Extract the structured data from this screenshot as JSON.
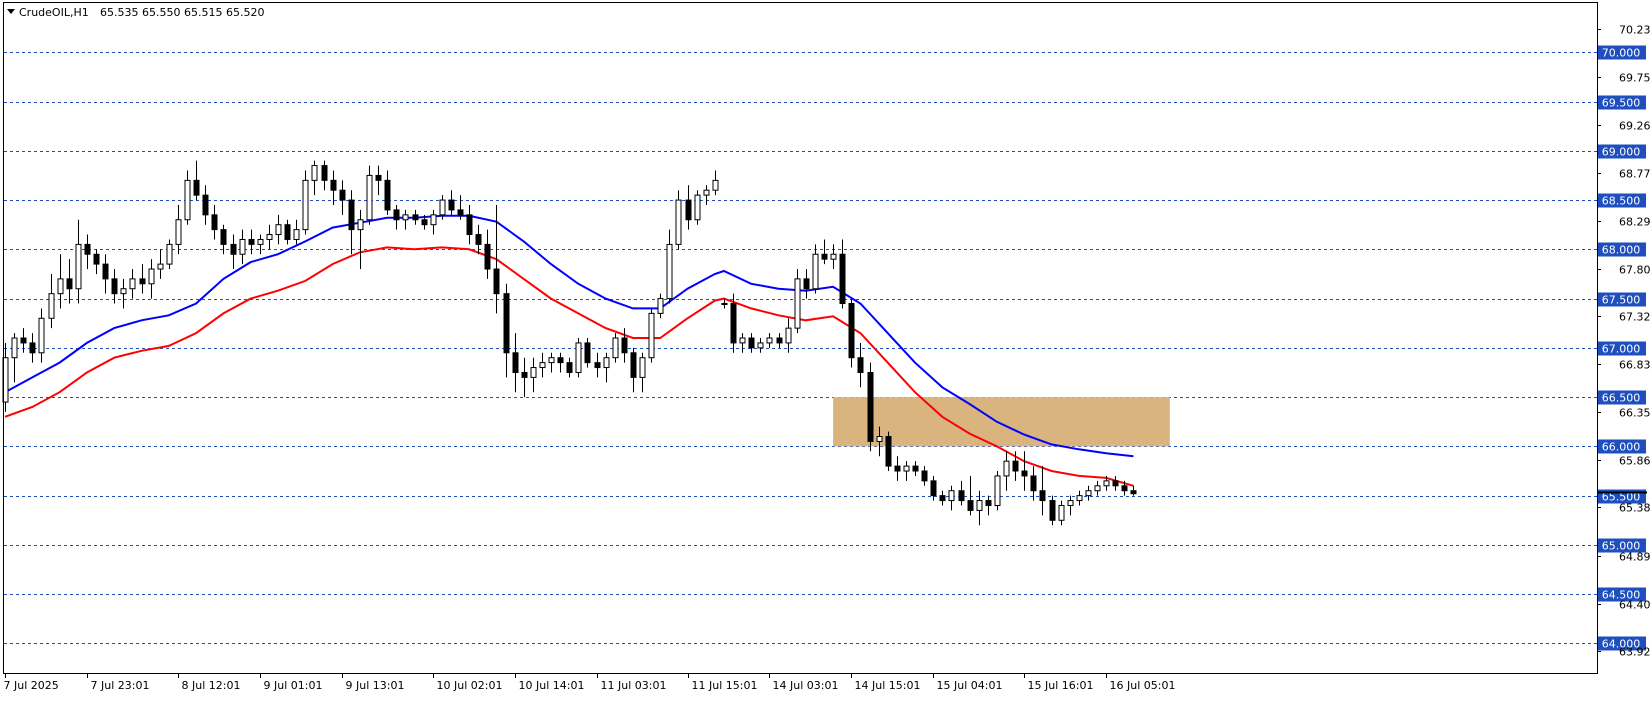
{
  "header": {
    "symbol": "CrudeOIL,H1",
    "ohlc": "65.535 65.550 65.515 65.520"
  },
  "colors": {
    "ma_fast": "#ff0000",
    "ma_slow": "#0000ff",
    "level_line": "#1f4fbf",
    "level_badge": "#1f4fbf",
    "resistance_zone": "#d9b47f",
    "candle": "#000000"
  },
  "icons": {
    "header_menu": "triangle-down-icon"
  },
  "chart_data": {
    "type": "candlestick",
    "title": "CrudeOIL,H1",
    "ylim": [
      63.7,
      70.5
    ],
    "price_ticks": [
      "70.235",
      "69.750",
      "69.265",
      "68.775",
      "68.290",
      "67.805",
      "67.320",
      "66.835",
      "66.350",
      "65.865",
      "65.380",
      "64.890",
      "64.405",
      "63.920"
    ],
    "price_levels": [
      "70.000",
      "69.500",
      "69.000",
      "68.500",
      "68.000",
      "67.500",
      "67.000",
      "66.500",
      "66.000",
      "65.500",
      "65.000",
      "64.500",
      "64.000"
    ],
    "current_price": 65.52,
    "resistance_zone": {
      "low": 66.0,
      "high": 66.5,
      "from_bar": 91,
      "to_bar": 128
    },
    "time_labels": [
      {
        "bar": 0,
        "label": "7 Jul 2025"
      },
      {
        "bar": 9,
        "label": "7 Jul 23:01"
      },
      {
        "bar": 19,
        "label": "8 Jul 12:01"
      },
      {
        "bar": 28,
        "label": "9 Jul 01:01"
      },
      {
        "bar": 37,
        "label": "9 Jul 13:01"
      },
      {
        "bar": 47,
        "label": "10 Jul 02:01"
      },
      {
        "bar": 56,
        "label": "10 Jul 14:01"
      },
      {
        "bar": 65,
        "label": "11 Jul 03:01"
      },
      {
        "bar": 75,
        "label": "11 Jul 15:01"
      },
      {
        "bar": 84,
        "label": "14 Jul 03:01"
      },
      {
        "bar": 93,
        "label": "14 Jul 15:01"
      },
      {
        "bar": 102,
        "label": "15 Jul 04:01"
      },
      {
        "bar": 112,
        "label": "15 Jul 16:01"
      },
      {
        "bar": 121,
        "label": "16 Jul 05:01"
      }
    ],
    "series": [
      {
        "name": "",
        "type": "ohlc",
        "values": [
          [
            66.45,
            67.05,
            66.35,
            66.9
          ],
          [
            66.9,
            67.15,
            66.65,
            67.1
          ],
          [
            67.1,
            67.2,
            66.95,
            67.05
          ],
          [
            67.05,
            67.15,
            66.85,
            66.95
          ],
          [
            66.95,
            67.4,
            66.85,
            67.3
          ],
          [
            67.3,
            67.75,
            67.2,
            67.55
          ],
          [
            67.55,
            67.95,
            67.4,
            67.7
          ],
          [
            67.7,
            67.9,
            67.45,
            67.6
          ],
          [
            67.6,
            68.3,
            67.45,
            68.05
          ],
          [
            68.05,
            68.15,
            67.8,
            67.95
          ],
          [
            67.95,
            68.0,
            67.75,
            67.85
          ],
          [
            67.85,
            67.95,
            67.55,
            67.7
          ],
          [
            67.7,
            67.8,
            67.45,
            67.55
          ],
          [
            67.55,
            67.7,
            67.4,
            67.6
          ],
          [
            67.6,
            67.8,
            67.5,
            67.7
          ],
          [
            67.7,
            67.85,
            67.55,
            67.65
          ],
          [
            67.65,
            67.9,
            67.5,
            67.8
          ],
          [
            67.8,
            68.0,
            67.7,
            67.85
          ],
          [
            67.85,
            68.1,
            67.8,
            68.05
          ],
          [
            68.05,
            68.45,
            67.95,
            68.3
          ],
          [
            68.3,
            68.8,
            68.25,
            68.7
          ],
          [
            68.7,
            68.9,
            68.5,
            68.55
          ],
          [
            68.55,
            68.65,
            68.25,
            68.35
          ],
          [
            68.35,
            68.45,
            68.1,
            68.2
          ],
          [
            68.2,
            68.25,
            67.95,
            68.05
          ],
          [
            68.05,
            68.15,
            67.8,
            67.95
          ],
          [
            67.95,
            68.2,
            67.85,
            68.1
          ],
          [
            68.1,
            68.2,
            67.95,
            68.05
          ],
          [
            68.05,
            68.15,
            67.95,
            68.1
          ],
          [
            68.1,
            68.25,
            68.0,
            68.15
          ],
          [
            68.15,
            68.35,
            68.05,
            68.25
          ],
          [
            68.25,
            68.3,
            68.05,
            68.1
          ],
          [
            68.1,
            68.3,
            68.05,
            68.2
          ],
          [
            68.2,
            68.8,
            68.15,
            68.7
          ],
          [
            68.7,
            68.9,
            68.55,
            68.85
          ],
          [
            68.85,
            68.9,
            68.6,
            68.7
          ],
          [
            68.7,
            68.8,
            68.45,
            68.6
          ],
          [
            68.6,
            68.7,
            68.35,
            68.5
          ],
          [
            68.5,
            68.6,
            67.95,
            68.2
          ],
          [
            68.2,
            68.4,
            67.8,
            68.3
          ],
          [
            68.3,
            68.85,
            68.25,
            68.75
          ],
          [
            68.75,
            68.85,
            68.55,
            68.7
          ],
          [
            68.7,
            68.8,
            68.35,
            68.4
          ],
          [
            68.4,
            68.45,
            68.2,
            68.3
          ],
          [
            68.3,
            68.4,
            68.2,
            68.35
          ],
          [
            68.35,
            68.4,
            68.25,
            68.3
          ],
          [
            68.3,
            68.35,
            68.2,
            68.25
          ],
          [
            68.25,
            68.4,
            68.15,
            68.35
          ],
          [
            68.35,
            68.55,
            68.3,
            68.5
          ],
          [
            68.5,
            68.6,
            68.35,
            68.4
          ],
          [
            68.4,
            68.55,
            68.3,
            68.35
          ],
          [
            68.35,
            68.45,
            68.05,
            68.15
          ],
          [
            68.15,
            68.25,
            67.95,
            68.05
          ],
          [
            68.05,
            68.2,
            67.7,
            67.8
          ],
          [
            67.8,
            68.45,
            67.35,
            67.55
          ],
          [
            67.55,
            67.65,
            66.7,
            66.95
          ],
          [
            66.95,
            67.15,
            66.55,
            66.75
          ],
          [
            66.75,
            66.9,
            66.5,
            66.7
          ],
          [
            66.7,
            66.9,
            66.55,
            66.8
          ],
          [
            66.8,
            66.95,
            66.7,
            66.85
          ],
          [
            66.85,
            66.95,
            66.75,
            66.9
          ],
          [
            66.9,
            66.95,
            66.75,
            66.85
          ],
          [
            66.85,
            66.9,
            66.7,
            66.75
          ],
          [
            66.75,
            67.1,
            66.7,
            67.05
          ],
          [
            67.05,
            67.1,
            66.8,
            66.85
          ],
          [
            66.85,
            66.95,
            66.7,
            66.8
          ],
          [
            66.8,
            66.95,
            66.65,
            66.9
          ],
          [
            66.9,
            67.15,
            66.85,
            67.1
          ],
          [
            67.1,
            67.2,
            66.85,
            66.95
          ],
          [
            66.95,
            67.0,
            66.55,
            66.7
          ],
          [
            66.7,
            66.95,
            66.55,
            66.9
          ],
          [
            66.9,
            67.4,
            66.85,
            67.35
          ],
          [
            67.35,
            67.55,
            67.3,
            67.5
          ],
          [
            67.5,
            68.2,
            67.45,
            68.05
          ],
          [
            68.05,
            68.6,
            68.0,
            68.5
          ],
          [
            68.5,
            68.65,
            68.2,
            68.3
          ],
          [
            68.3,
            68.6,
            68.25,
            68.55
          ],
          [
            68.55,
            68.65,
            68.45,
            68.6
          ],
          [
            68.6,
            68.8,
            68.55,
            68.7
          ],
          [
            67.45,
            67.5,
            67.4,
            67.45
          ],
          [
            67.45,
            67.55,
            66.95,
            67.05
          ],
          [
            67.05,
            67.15,
            66.95,
            67.1
          ],
          [
            67.1,
            67.15,
            66.95,
            67.0
          ],
          [
            67.0,
            67.1,
            66.95,
            67.05
          ],
          [
            67.05,
            67.15,
            67.0,
            67.1
          ],
          [
            67.1,
            67.15,
            67.0,
            67.05
          ],
          [
            67.05,
            67.3,
            66.95,
            67.2
          ],
          [
            67.2,
            67.8,
            67.15,
            67.7
          ],
          [
            67.7,
            67.8,
            67.5,
            67.6
          ],
          [
            67.6,
            68.05,
            67.55,
            67.95
          ],
          [
            67.95,
            68.1,
            67.85,
            67.9
          ],
          [
            67.9,
            68.05,
            67.8,
            67.95
          ],
          [
            67.95,
            68.1,
            67.4,
            67.45
          ],
          [
            67.45,
            67.5,
            66.8,
            66.9
          ],
          [
            66.9,
            67.05,
            66.6,
            66.75
          ],
          [
            66.75,
            66.85,
            65.95,
            66.05
          ],
          [
            66.05,
            66.2,
            65.9,
            66.1
          ],
          [
            66.1,
            66.15,
            65.75,
            65.8
          ],
          [
            65.8,
            65.9,
            65.65,
            65.75
          ],
          [
            65.75,
            65.85,
            65.65,
            65.8
          ],
          [
            65.8,
            65.85,
            65.7,
            65.75
          ],
          [
            65.75,
            65.8,
            65.6,
            65.65
          ],
          [
            65.65,
            65.7,
            65.45,
            65.5
          ],
          [
            65.5,
            65.55,
            65.4,
            65.45
          ],
          [
            65.45,
            65.6,
            65.35,
            65.55
          ],
          [
            65.55,
            65.65,
            65.4,
            65.45
          ],
          [
            65.45,
            65.7,
            65.3,
            65.35
          ],
          [
            65.35,
            65.55,
            65.2,
            65.45
          ],
          [
            65.45,
            65.5,
            65.3,
            65.4
          ],
          [
            65.4,
            65.75,
            65.35,
            65.7
          ],
          [
            65.7,
            65.95,
            65.55,
            65.85
          ],
          [
            65.85,
            65.95,
            65.65,
            65.75
          ],
          [
            65.75,
            65.95,
            65.55,
            65.7
          ],
          [
            65.7,
            65.8,
            65.45,
            65.55
          ],
          [
            65.55,
            65.8,
            65.3,
            65.45
          ],
          [
            65.45,
            65.5,
            65.2,
            65.25
          ],
          [
            65.25,
            65.45,
            65.2,
            65.4
          ],
          [
            65.4,
            65.5,
            65.3,
            65.45
          ],
          [
            65.45,
            65.55,
            65.4,
            65.5
          ],
          [
            65.5,
            65.6,
            65.45,
            65.55
          ],
          [
            65.55,
            65.65,
            65.5,
            65.6
          ],
          [
            65.6,
            65.7,
            65.55,
            65.65
          ],
          [
            65.65,
            65.7,
            65.55,
            65.6
          ],
          [
            65.6,
            65.65,
            65.5,
            65.55
          ],
          [
            65.55,
            65.6,
            65.5,
            65.52
          ]
        ]
      },
      {
        "name": "",
        "type": "ma",
        "color": "#ff0000",
        "values": [
          [
            0,
            66.3
          ],
          [
            3,
            66.4
          ],
          [
            6,
            66.55
          ],
          [
            9,
            66.75
          ],
          [
            12,
            66.9
          ],
          [
            15,
            66.97
          ],
          [
            18,
            67.02
          ],
          [
            21,
            67.15
          ],
          [
            24,
            67.35
          ],
          [
            27,
            67.5
          ],
          [
            30,
            67.58
          ],
          [
            33,
            67.68
          ],
          [
            36,
            67.85
          ],
          [
            39,
            67.97
          ],
          [
            42,
            68.02
          ],
          [
            45,
            68.0
          ],
          [
            48,
            68.02
          ],
          [
            51,
            68.0
          ],
          [
            54,
            67.9
          ],
          [
            57,
            67.7
          ],
          [
            60,
            67.5
          ],
          [
            63,
            67.35
          ],
          [
            66,
            67.2
          ],
          [
            69,
            67.1
          ],
          [
            72,
            67.1
          ],
          [
            75,
            67.3
          ],
          [
            78,
            67.48
          ],
          [
            79,
            67.5
          ],
          [
            82,
            67.4
          ],
          [
            85,
            67.33
          ],
          [
            88,
            67.28
          ],
          [
            91,
            67.32
          ],
          [
            94,
            67.15
          ],
          [
            97,
            66.85
          ],
          [
            100,
            66.55
          ],
          [
            103,
            66.3
          ],
          [
            106,
            66.13
          ],
          [
            109,
            66.0
          ],
          [
            112,
            65.85
          ],
          [
            115,
            65.75
          ],
          [
            118,
            65.7
          ],
          [
            121,
            65.68
          ],
          [
            124,
            65.6
          ]
        ]
      },
      {
        "name": "",
        "type": "ma",
        "color": "#0000ff",
        "values": [
          [
            0,
            66.55
          ],
          [
            3,
            66.7
          ],
          [
            6,
            66.85
          ],
          [
            9,
            67.05
          ],
          [
            12,
            67.2
          ],
          [
            15,
            67.28
          ],
          [
            18,
            67.33
          ],
          [
            21,
            67.45
          ],
          [
            24,
            67.7
          ],
          [
            27,
            67.87
          ],
          [
            30,
            67.95
          ],
          [
            33,
            68.08
          ],
          [
            36,
            68.22
          ],
          [
            39,
            68.27
          ],
          [
            42,
            68.32
          ],
          [
            45,
            68.32
          ],
          [
            48,
            68.34
          ],
          [
            51,
            68.34
          ],
          [
            54,
            68.28
          ],
          [
            57,
            68.08
          ],
          [
            60,
            67.85
          ],
          [
            63,
            67.65
          ],
          [
            66,
            67.5
          ],
          [
            69,
            67.4
          ],
          [
            72,
            67.4
          ],
          [
            75,
            67.6
          ],
          [
            78,
            67.75
          ],
          [
            79,
            67.78
          ],
          [
            82,
            67.65
          ],
          [
            85,
            67.6
          ],
          [
            88,
            67.58
          ],
          [
            91,
            67.62
          ],
          [
            94,
            67.45
          ],
          [
            97,
            67.15
          ],
          [
            100,
            66.85
          ],
          [
            103,
            66.6
          ],
          [
            106,
            66.43
          ],
          [
            109,
            66.25
          ],
          [
            112,
            66.12
          ],
          [
            115,
            66.02
          ],
          [
            118,
            65.97
          ],
          [
            121,
            65.93
          ],
          [
            124,
            65.9
          ]
        ]
      }
    ]
  }
}
